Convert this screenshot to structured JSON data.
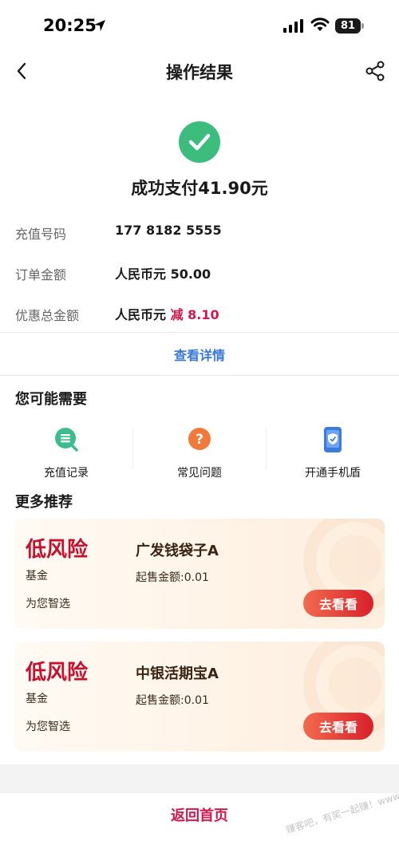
{
  "status_bar": {
    "time": "20:25",
    "battery": "81"
  },
  "nav": {
    "title": "操作结果"
  },
  "result": {
    "message": "成功支付41.90元"
  },
  "info_rows": [
    {
      "label": "充值号码",
      "value": "177 8182 5555"
    },
    {
      "label": "订单金额",
      "value": "人民币元 50.00"
    },
    {
      "label": "优惠总金额",
      "value_prefix": "人民币元",
      "value_discount": "减 8.10"
    }
  ],
  "detail_link": "查看详情",
  "section_maybe": "您可能需要",
  "quick_actions": [
    {
      "label": "充值记录",
      "icon": "recharge-record-icon",
      "color": "#3dbd8d"
    },
    {
      "label": "常见问题",
      "icon": "question-icon",
      "color": "#f07a3a"
    },
    {
      "label": "开通手机盾",
      "icon": "phone-shield-icon",
      "color": "#3a7be0"
    }
  ],
  "section_more": "更多推荐",
  "recommendations": [
    {
      "risk": "低风险",
      "type": "基金",
      "note": "为您智选",
      "name": "广发钱袋子A",
      "min_amount": "起售金额:0.01",
      "button": "去看看"
    },
    {
      "risk": "低风险",
      "type": "基金",
      "note": "为您智选",
      "name": "中银活期宝A",
      "min_amount": "起售金额:0.01",
      "button": "去看看"
    }
  ],
  "home_button": "返回首页",
  "watermark": "赚客吧，有奖一起赚！www.zuanke8.com",
  "colors": {
    "accent_red": "#d4174b",
    "link_blue": "#3a78d8",
    "success_green": "#3dbd7d"
  }
}
